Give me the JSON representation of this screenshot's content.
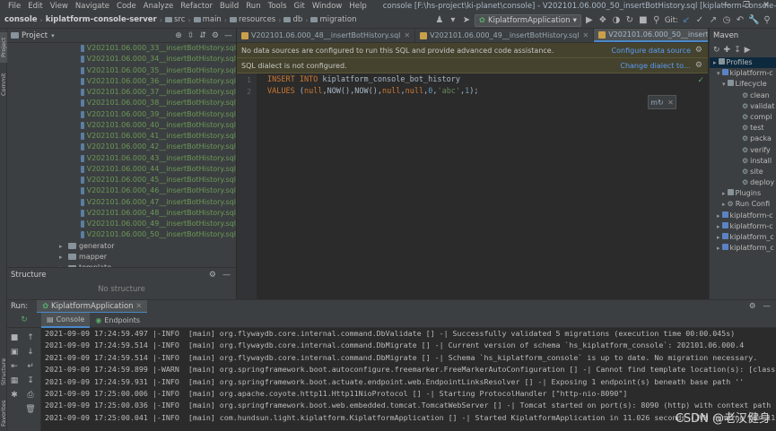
{
  "menubar": {
    "items": [
      "File",
      "Edit",
      "View",
      "Navigate",
      "Code",
      "Analyze",
      "Refactor",
      "Build",
      "Run",
      "Tools",
      "Git",
      "Window",
      "Help"
    ],
    "window_title": "console [F:\\hs-project\\ki-planet\\console] - V202101.06.000_50_insertBotHistory.sql [kiplatform-console-server]"
  },
  "navbar": {
    "crumbs": [
      "console",
      "kiplatform-console-server",
      "src",
      "main",
      "resources",
      "db",
      "migration"
    ],
    "run_config": "KiplatformApplication",
    "git_label": "Git:"
  },
  "sidebar": {
    "project_tab": "Project",
    "commit_tab": "Commit",
    "structure_tab": "Structure",
    "favorites_tab": "Favorites"
  },
  "project": {
    "title": "Project",
    "files": [
      "V202101.06.000_33__insertBotHistory.sql",
      "V202101.06.000_34__insertBotHistory.sql",
      "V202101.06.000_35__insertBotHistory.sql",
      "V202101.06.000_36__insertBotHistory.sql",
      "V202101.06.000_37__insertBotHistory.sql",
      "V202101.06.000_38__insertBotHistory.sql",
      "V202101.06.000_39__insertBotHistory.sql",
      "V202101.06.000_40__insertBotHistory.sql",
      "V202101.06.000_41__insertBotHistory.sql",
      "V202101.06.000_42__insertBotHistory.sql",
      "V202101.06.000_43__insertBotHistory.sql",
      "V202101.06.000_44__insertBotHistory.sql",
      "V202101.06.000_45__insertBotHistory.sql",
      "V202101.06.000_46__insertBotHistory.sql",
      "V202101.06.000_47__insertBotHistory.sql",
      "V202101.06.000_48__insertBotHistory.sql",
      "V202101.06.000_49__insertBotHistory.sql",
      "V202101.06.000_50__insertBotHistory.sql"
    ],
    "folders": [
      "generator",
      "mapper",
      "template"
    ]
  },
  "structure": {
    "title": "Structure",
    "empty": "No structure"
  },
  "editor": {
    "tabs": [
      "V202101.06.000_48__insertBotHistory.sql",
      "V202101.06.000_49__insertBotHistory.sql",
      "V202101.06.000_50__insertBotHistory.sql"
    ],
    "banner1_text": "No data sources are configured to run this SQL and provide advanced code assistance.",
    "banner1_link": "Configure data source",
    "banner2_text": "SQL dialect is not configured.",
    "banner2_link": "Change dialect to…",
    "line_numbers": [
      "1",
      "2"
    ]
  },
  "maven": {
    "title": "Maven",
    "tree": [
      "Profiles",
      "kiplatform-c",
      "Lifecycle",
      "clean",
      "validat",
      "compi",
      "test",
      "packa",
      "verify",
      "install",
      "site",
      "deploy",
      "Plugins",
      "Run Confi",
      "kiplatform-c",
      "kiplatform-c",
      "kiplatform_c",
      "kiplatform_c"
    ]
  },
  "run": {
    "label": "Run:",
    "tab": "KiplatformApplication",
    "console_tab": "Console",
    "endpoints_tab": "Endpoints",
    "logs": [
      "2021-09-09 17:24:59.497 |-INFO  [main] org.flywaydb.core.internal.command.DbValidate [] -| Successfully validated 5 migrations (execution time 00:00.045s)",
      "2021-09-09 17:24:59.514 |-INFO  [main] org.flywaydb.core.internal.command.DbMigrate [] -| Current version of schema `hs_kiplatform_console`: 202101.06.000.4",
      "2021-09-09 17:24:59.514 |-INFO  [main] org.flywaydb.core.internal.command.DbMigrate [] -| Schema `hs_kiplatform_console` is up to date. No migration necessary.",
      "2021-09-09 17:24:59.899 |-WARN  [main] org.springframework.boot.autoconfigure.freemarker.FreeMarkerAutoConfiguration [] -| Cannot find template location(s): [classpat",
      "2021-09-09 17:24:59.931 |-INFO  [main] org.springframework.boot.actuate.endpoint.web.EndpointLinksResolver [] -| Exposing 1 endpoint(s) beneath base path ''",
      "2021-09-09 17:25:00.006 |-INFO  [main] org.apache.coyote.http11.Http11NioProtocol [] -| Starting ProtocolHandler [\"http-nio-8090\"]",
      "2021-09-09 17:25:00.036 |-INFO  [main] org.springframework.boot.web.embedded.tomcat.TomcatWebServer [] -| Tomcat started on port(s): 8090 (http) with context path",
      "2021-09-09 17:25:00.041 |-INFO  [main] com.hundsun.light.kiplatform.KiplatformApplication [] -| Started KiplatformApplication in 11.026 seconds (JVM running for 11.75"
    ]
  },
  "watermark": "CSDN @老汉健身",
  "colors": {
    "accent": "#4a88c7",
    "file_green": "#6a9955",
    "keyword": "#cc7832",
    "string": "#6a8759",
    "number": "#6897bb",
    "banner": "#45422d",
    "link": "#589df6"
  }
}
